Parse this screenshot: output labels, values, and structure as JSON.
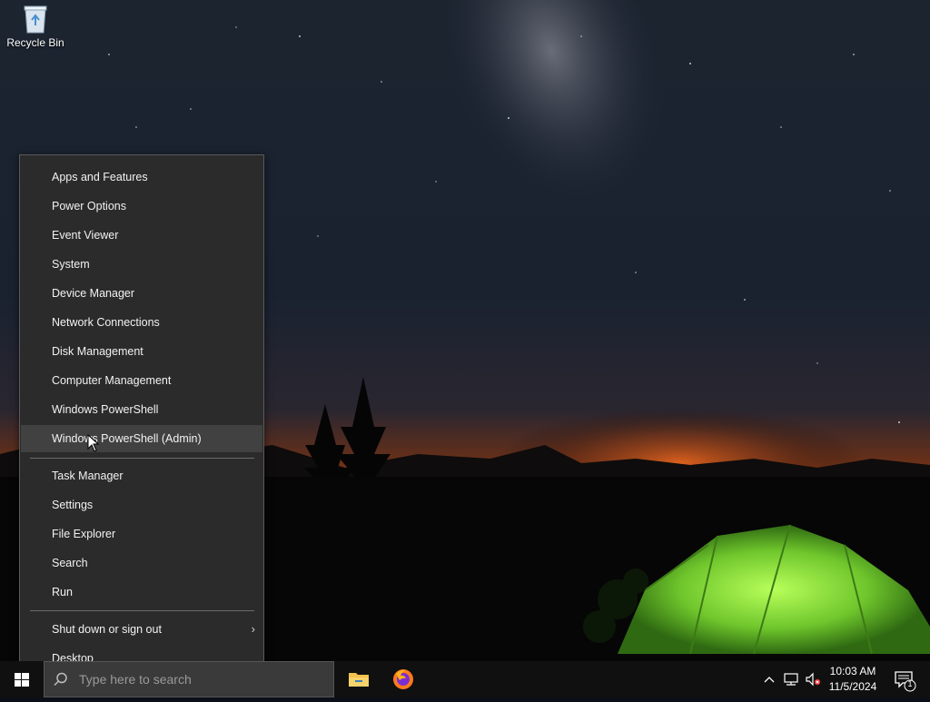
{
  "desktop": {
    "icons": [
      {
        "label": "Recycle Bin",
        "icon": "recycle-bin-icon"
      }
    ]
  },
  "context_menu": {
    "group1": [
      {
        "label": "Apps and Features"
      },
      {
        "label": "Power Options"
      },
      {
        "label": "Event Viewer"
      },
      {
        "label": "System"
      },
      {
        "label": "Device Manager"
      },
      {
        "label": "Network Connections"
      },
      {
        "label": "Disk Management"
      },
      {
        "label": "Computer Management"
      },
      {
        "label": "Windows PowerShell"
      },
      {
        "label": "Windows PowerShell (Admin)",
        "highlighted": true
      }
    ],
    "group2": [
      {
        "label": "Task Manager"
      },
      {
        "label": "Settings"
      },
      {
        "label": "File Explorer"
      },
      {
        "label": "Search"
      },
      {
        "label": "Run"
      }
    ],
    "group3": [
      {
        "label": "Shut down or sign out",
        "has_submenu": true,
        "submenu_arrow": "›"
      },
      {
        "label": "Desktop"
      }
    ]
  },
  "taskbar": {
    "search_placeholder": "Type here to search",
    "pinned": [
      {
        "name": "File Explorer",
        "icon": "folder-icon"
      },
      {
        "name": "Firefox",
        "icon": "firefox-icon"
      }
    ],
    "tray": {
      "chevron": "^",
      "clock_time": "10:03 AM",
      "clock_date": "11/5/2024",
      "notification_count": "1"
    }
  },
  "colors": {
    "menu_bg": "#2b2b2b",
    "menu_hover": "#414141",
    "taskbar_bg": "#101010",
    "accent_tent": "#7fd63a"
  }
}
